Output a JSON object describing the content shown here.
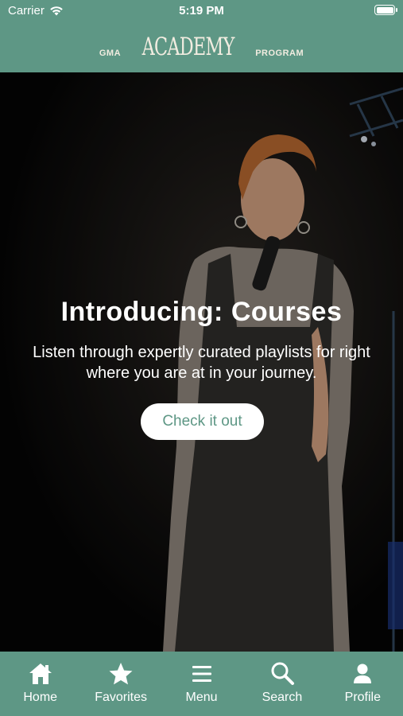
{
  "status_bar": {
    "carrier": "Carrier",
    "time": "5:19 PM"
  },
  "header": {
    "logo_left": "GMA",
    "logo_main": "ACADEMY",
    "logo_right": "PROGRAM",
    "background_color": "#5e9785"
  },
  "hero": {
    "title": "Introducing: Courses",
    "subtitle": "Listen through expertly curated playlists for right where you are at in your journey.",
    "cta_label": "Check it out"
  },
  "tab_bar": {
    "items": [
      {
        "label": "Home",
        "icon": "home-icon"
      },
      {
        "label": "Favorites",
        "icon": "star-icon"
      },
      {
        "label": "Menu",
        "icon": "menu-icon"
      },
      {
        "label": "Search",
        "icon": "search-icon"
      },
      {
        "label": "Profile",
        "icon": "profile-icon"
      }
    ]
  },
  "colors": {
    "accent": "#5e9785",
    "label_light": "#f1ece0"
  }
}
